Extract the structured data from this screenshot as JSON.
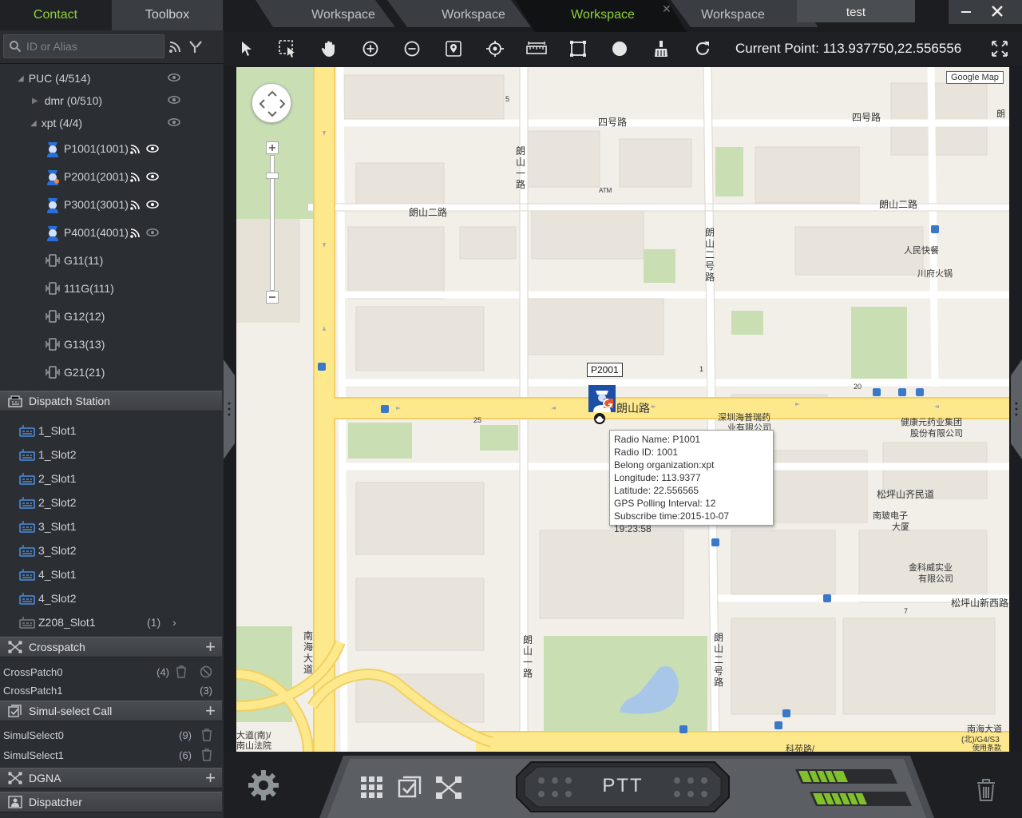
{
  "left_tabs": [
    "Contact",
    "Toolbox"
  ],
  "search": {
    "placeholder": "ID or Alias"
  },
  "tree": {
    "root": "PUC (4/514)",
    "groups": [
      {
        "label": "dmr (0/510)"
      },
      {
        "label": "xpt (4/4)"
      }
    ],
    "radios": [
      "P1001(1001)",
      "P2001(2001)",
      "P3001(3001)",
      "P4001(4001)"
    ],
    "gateways": [
      "G11(11)",
      "111G(111)",
      "G12(12)",
      "G13(13)",
      "G21(21)"
    ]
  },
  "dispatch": {
    "title": "Dispatch Station",
    "slots": [
      "1_Slot1",
      "1_Slot2",
      "2_Slot1",
      "2_Slot2",
      "3_Slot1",
      "3_Slot2",
      "4_Slot1",
      "4_Slot2",
      "Z208_Slot1"
    ],
    "z_count": "(1)"
  },
  "crosspatch": {
    "title": "Crosspatch",
    "items": [
      {
        "name": "CrossPatch0",
        "count": "(4)"
      },
      {
        "name": "CrossPatch1",
        "count": "(3)"
      }
    ]
  },
  "simul": {
    "title": "Simul-select Call",
    "items": [
      {
        "name": "SimulSelect0",
        "count": "(9)"
      },
      {
        "name": "SimulSelect1",
        "count": "(6)"
      }
    ]
  },
  "dgna": {
    "title": "DGNA"
  },
  "dispatcher": {
    "title": "Dispatcher"
  },
  "workspace_tabs": [
    "Workspace",
    "Workspace",
    "Workspace",
    "Workspace"
  ],
  "user_tab": "test",
  "current_point": "Current Point: 113.937750,22.556556",
  "map": {
    "provider": "Google Map",
    "marker_label": "P2001",
    "street_labels": [
      "四号路",
      "四号路",
      "朗山二路",
      "朗山二路",
      "朗山二号路",
      "朗山路",
      "朗山一路",
      "朗山二号路",
      "朗山一路",
      "南海大道",
      "松坪山齐民道",
      "松坪山新西路",
      "科苑路/",
      "南海大道",
      "(北)/G4/S3",
      "使用条款",
      "大道(南)/",
      "南山法院",
      "人民快餐",
      "川府火锅",
      "深圳海普瑞药",
      "业有限公司",
      "健康元药业集团",
      "股份有限公司",
      "南玻电子",
      "大厦",
      "金科威实业",
      "有限公司",
      "ATM",
      "5",
      "20",
      "25",
      "7",
      "1",
      "朗"
    ],
    "popup": [
      "Radio Name: P1001",
      "Radio ID: 1001",
      "Belong organization:xpt",
      "Longitude: 113.9377",
      "Latitude: 22.556565",
      "GPS Polling Interval: 12",
      "Subscribe time:2015-10-07 19:23:58"
    ]
  },
  "ptt_label": "PTT",
  "colors": {
    "accent": "#8fd23a",
    "road": "#fde98c",
    "map_bg": "#f2efe9"
  }
}
